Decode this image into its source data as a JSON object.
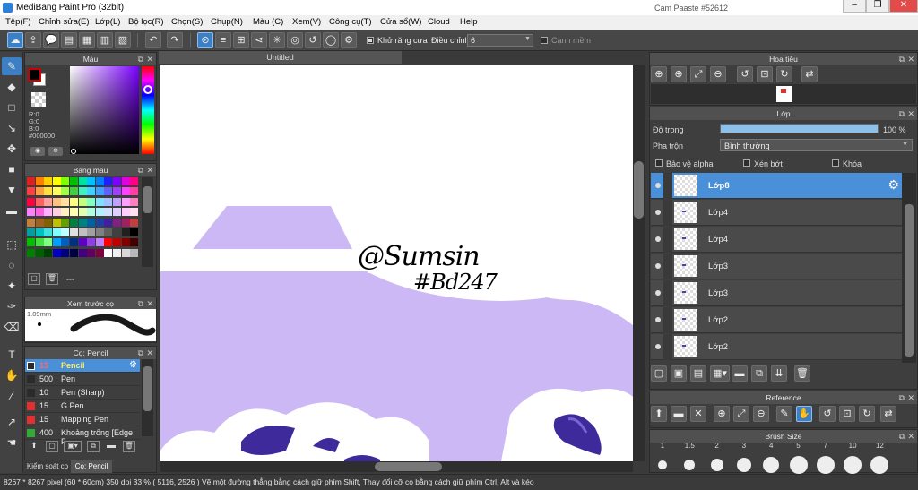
{
  "window": {
    "title": "MediBang Paint Pro (32bit)",
    "bg_tabs": [
      "",
      "Cam Paaste #52612"
    ],
    "min": "–",
    "restore": "❐",
    "close": "✕"
  },
  "menu": [
    "Tệp(F)",
    "Chỉnh sửa(E)",
    "Lớp(L)",
    "Bộ lọc(R)",
    "Chọn(S)",
    "Chụp(N)",
    "Màu (C)",
    "Xem(V)",
    "Công cụ(T)",
    "Cửa sổ(W)",
    "Cloud",
    "Help"
  ],
  "toolbar": {
    "antialias_label": "Khử răng cưa",
    "antialias_checked": true,
    "adjust_label": "Điều chỉnh",
    "adjust_value": "6",
    "soften_label": "Cạnh mềm",
    "soften_checked": false
  },
  "color_panel": {
    "title": "Màu",
    "r": "R:0",
    "g": "G:0",
    "b": "B:0",
    "hex": "#000000",
    "fg": "#000000",
    "bg": "#ffffff",
    "accent": "#cc0000"
  },
  "palette_panel": {
    "title": "Bảng màu",
    "more": "---"
  },
  "preview_panel": {
    "title": "Xem trước cọ",
    "size": "1.09mm"
  },
  "brush_panel": {
    "title": "Cọ: Pencil",
    "brushes": [
      {
        "size": "15",
        "name": "Pencil",
        "color": "#2b2b2b",
        "selected": true
      },
      {
        "size": "500",
        "name": "Pen",
        "color": "#2b2b2b",
        "selected": false
      },
      {
        "size": "10",
        "name": "Pen (Sharp)",
        "color": "#2b2b2b",
        "selected": false
      },
      {
        "size": "15",
        "name": "G Pen",
        "color": "#e03030",
        "selected": false
      },
      {
        "size": "15",
        "name": "Mapping Pen",
        "color": "#e03030",
        "selected": false
      },
      {
        "size": "400",
        "name": "Khoảng trống [Edge F",
        "color": "#33aa33",
        "selected": false
      }
    ],
    "tab_control": "Kiểm soát cọ",
    "tab_brush": "Cọ: Pencil"
  },
  "document": {
    "tab": "Untitled",
    "signature_line1": "@Sumsin",
    "signature_line2": "#Bd247"
  },
  "navigator": {
    "title": "Hoa tiêu"
  },
  "layer_panel": {
    "title": "Lớp",
    "opacity_label": "Độ trong",
    "opacity_value": "100 %",
    "opacity": 1.0,
    "blend_label": "Pha trộn",
    "blend_value": "Bình thường",
    "protect_alpha": "Bảo vệ alpha",
    "clipping": "Xén bớt",
    "lock": "Khóa",
    "layers": [
      {
        "name": "Lớp8",
        "selected": true
      },
      {
        "name": "Lớp4",
        "selected": false
      },
      {
        "name": "Lớp4",
        "selected": false
      },
      {
        "name": "Lớp3",
        "selected": false
      },
      {
        "name": "Lớp3",
        "selected": false
      },
      {
        "name": "Lớp2",
        "selected": false
      },
      {
        "name": "Lớp2",
        "selected": false
      }
    ]
  },
  "reference_panel": {
    "title": "Reference"
  },
  "brush_size_panel": {
    "title": "Brush Size",
    "sizes": [
      "1",
      "1.5",
      "2",
      "3",
      "4",
      "5",
      "7",
      "10",
      "12"
    ]
  },
  "status": "8267 * 8267 pixel   (60 * 60cm)   350 dpi   33 %   ( 5116, 2526 )   Vẽ một đường thẳng bằng cách giữ phím Shift, Thay đổi cỡ cọ bằng cách giữ phím Ctrl, Alt và kéo"
}
